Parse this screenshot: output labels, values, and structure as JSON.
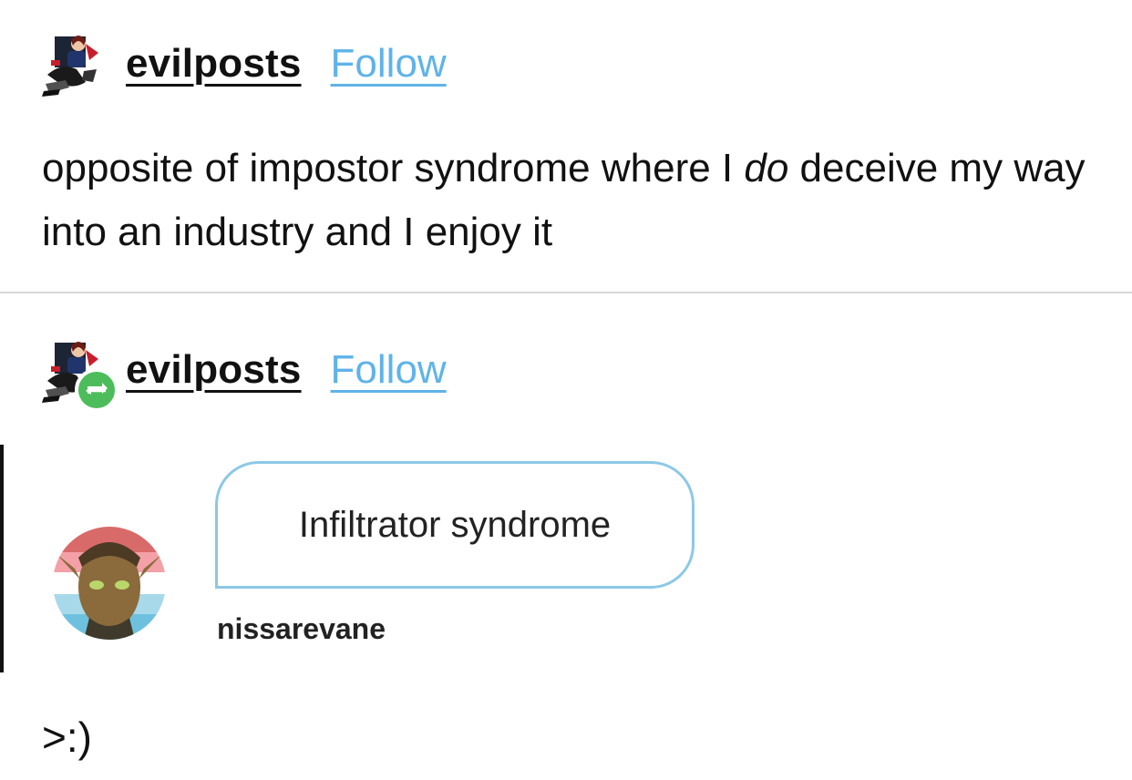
{
  "posts": [
    {
      "blog_name": "evilposts",
      "follow_label": "Follow",
      "body_before": "opposite of impostor syndrome where I ",
      "body_em": "do",
      "body_after": " deceive my way into an industry and I enjoy it"
    },
    {
      "blog_name": "evilposts",
      "follow_label": "Follow",
      "reblog_icon": "reblog-icon",
      "quoted_image": {
        "bubble_text": "Infiltrator syndrome",
        "username": "nissarevane"
      },
      "closing_text": ">:)"
    }
  ],
  "colors": {
    "follow": "#5fb3e8",
    "reblog_badge": "#4cbd5a",
    "bubble_border": "#8cc8e6",
    "divider": "#d6d6d6"
  }
}
